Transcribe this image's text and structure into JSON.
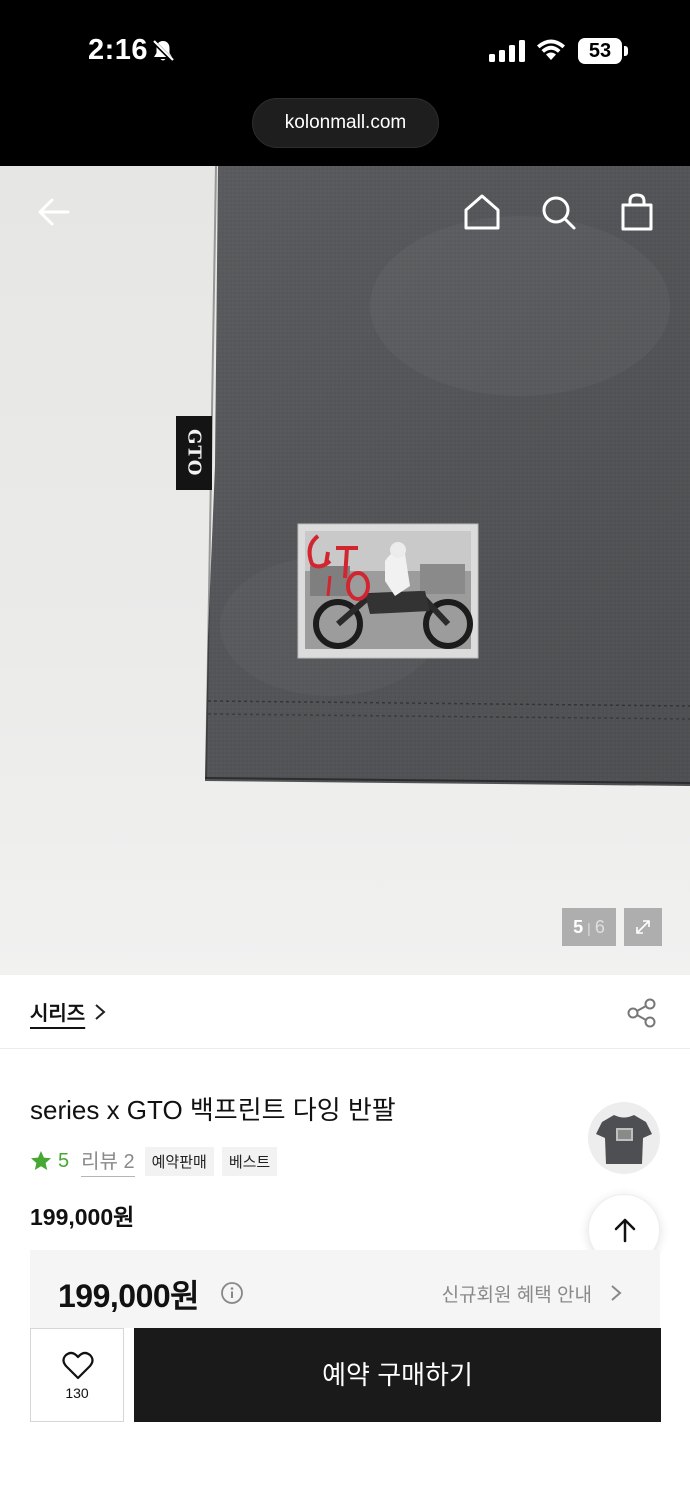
{
  "status_bar": {
    "time": "2:16",
    "battery": "53",
    "url": "kolonmall.com"
  },
  "hero": {
    "icons": [
      "back-arrow-icon",
      "home-icon",
      "search-icon",
      "shopping-bag-icon",
      "expand-icon"
    ],
    "image_current": "5",
    "image_separator": "|",
    "image_total": "6",
    "label_text": "GTO"
  },
  "series": {
    "label": "시리즈",
    "chevron": ">"
  },
  "product": {
    "title": "series x GTO 백프린트 다잉 반팔",
    "rating": "5",
    "review_label": "리뷰 2",
    "tags": [
      "예약판매",
      "베스트"
    ],
    "price": "199,000원"
  },
  "benefit": {
    "price": "199,000원",
    "link_label": "신규회원 혜택 안내"
  },
  "actions": {
    "wish_count": "130",
    "buy_label": "예약 구매하기"
  },
  "colors": {
    "rating_star": "#46a832",
    "buy_button": "#1a1a1a",
    "shirt": "#545659"
  }
}
